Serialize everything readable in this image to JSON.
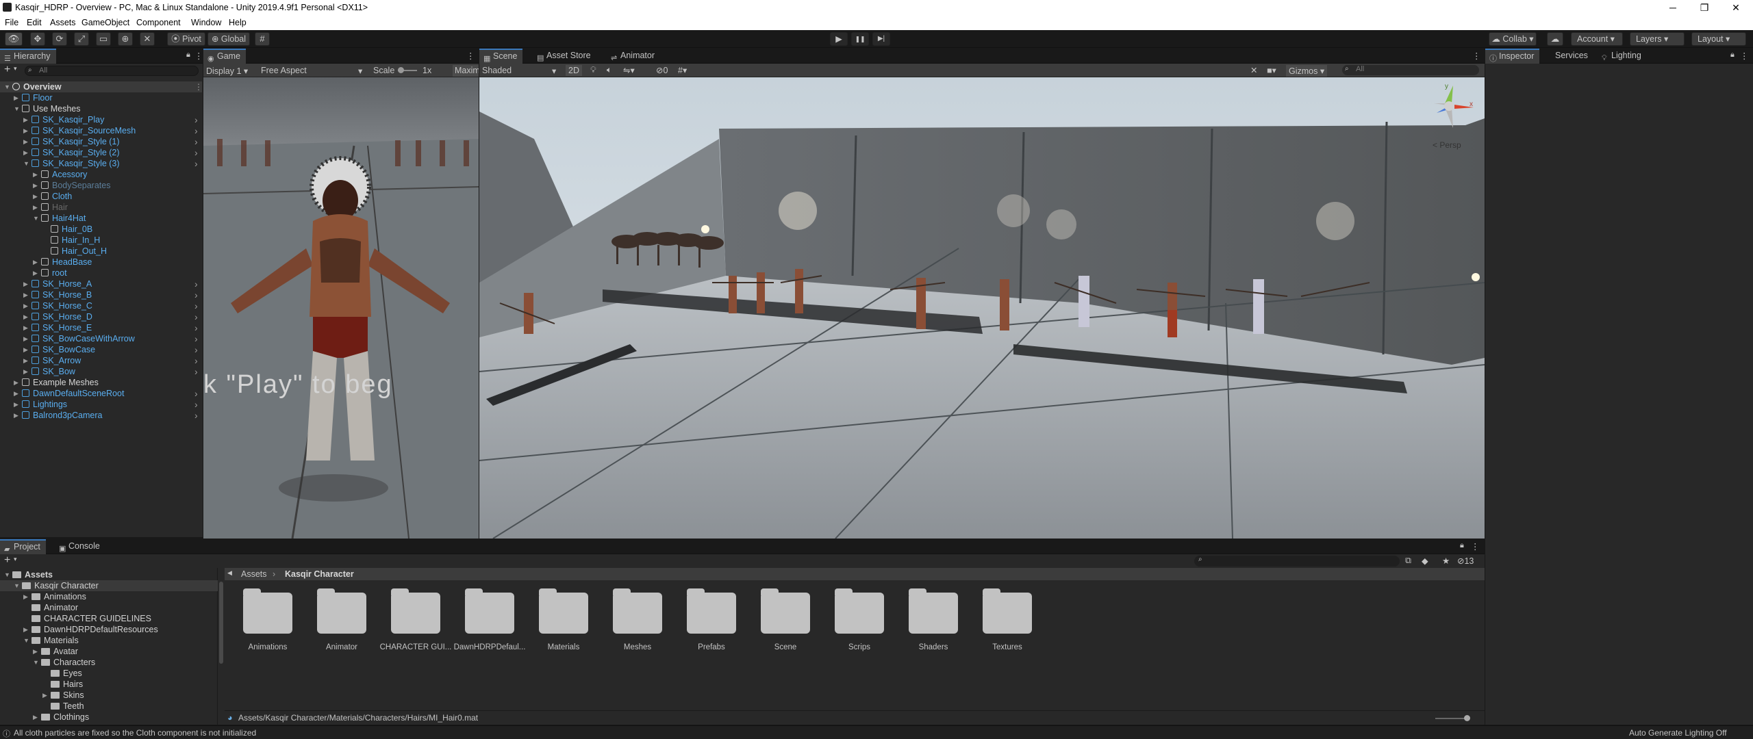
{
  "window": {
    "title": "Kasqir_HDRP - Overview - PC, Mac & Linux Standalone - Unity 2019.4.9f1 Personal <DX11>",
    "min": "─",
    "max": "❐",
    "close": "✕"
  },
  "menu": [
    "File",
    "Edit",
    "Assets",
    "GameObject",
    "Component",
    "Window",
    "Help"
  ],
  "toolbar": {
    "pivot": "Pivot",
    "global": "Global",
    "play": "▶",
    "pause": "❚❚",
    "step": "▶|",
    "collab": "Collab",
    "account": "Account",
    "layers": "Layers",
    "layout": "Layout"
  },
  "hierarchy": {
    "tab": "Hierarchy",
    "search_placeholder": "All",
    "add": "+",
    "items": [
      {
        "label": "Overview",
        "d": 0,
        "exp": "open",
        "ic": "unity",
        "c": "white"
      },
      {
        "label": "Floor",
        "d": 1,
        "exp": "closed",
        "ic": "cube",
        "c": "blue"
      },
      {
        "label": "Use Meshes",
        "d": 1,
        "exp": "open",
        "ic": "gray",
        "c": "white"
      },
      {
        "label": "SK_Kasqir_Play",
        "d": 2,
        "exp": "closed",
        "ic": "cube",
        "c": "blue",
        "more": 1
      },
      {
        "label": "SK_Kasqir_SourceMesh",
        "d": 2,
        "exp": "closed",
        "ic": "cube",
        "c": "blue",
        "more": 1
      },
      {
        "label": "SK_Kasqir_Style (1)",
        "d": 2,
        "exp": "closed",
        "ic": "cube",
        "c": "blue",
        "more": 1
      },
      {
        "label": "SK_Kasqir_Style (2)",
        "d": 2,
        "exp": "closed",
        "ic": "cube",
        "c": "blue",
        "more": 1
      },
      {
        "label": "SK_Kasqir_Style (3)",
        "d": 2,
        "exp": "open",
        "ic": "cube",
        "c": "blue",
        "more": 1
      },
      {
        "label": "Acessory",
        "d": 3,
        "exp": "closed",
        "ic": "gray",
        "c": "blue"
      },
      {
        "label": "BodySeparates",
        "d": 3,
        "exp": "closed",
        "ic": "gray",
        "c": "dim"
      },
      {
        "label": "Cloth",
        "d": 3,
        "exp": "closed",
        "ic": "gray",
        "c": "blue"
      },
      {
        "label": "Hair",
        "d": 3,
        "exp": "closed",
        "ic": "gray",
        "c": "dim2"
      },
      {
        "label": "Hair4Hat",
        "d": 3,
        "exp": "open",
        "ic": "gray",
        "c": "blue"
      },
      {
        "label": "Hair_0B",
        "d": 4,
        "exp": "",
        "ic": "gray",
        "c": "blue"
      },
      {
        "label": "Hair_In_H",
        "d": 4,
        "exp": "",
        "ic": "gray",
        "c": "blue"
      },
      {
        "label": "Hair_Out_H",
        "d": 4,
        "exp": "",
        "ic": "gray",
        "c": "blue"
      },
      {
        "label": "HeadBase",
        "d": 3,
        "exp": "closed",
        "ic": "gray",
        "c": "blue"
      },
      {
        "label": "root",
        "d": 3,
        "exp": "closed",
        "ic": "gray",
        "c": "blue"
      },
      {
        "label": "SK_Horse_A",
        "d": 2,
        "exp": "closed",
        "ic": "cube",
        "c": "blue",
        "more": 1
      },
      {
        "label": "SK_Horse_B",
        "d": 2,
        "exp": "closed",
        "ic": "cube",
        "c": "blue",
        "more": 1
      },
      {
        "label": "SK_Horse_C",
        "d": 2,
        "exp": "closed",
        "ic": "cube",
        "c": "blue",
        "more": 1
      },
      {
        "label": "SK_Horse_D",
        "d": 2,
        "exp": "closed",
        "ic": "cube",
        "c": "blue",
        "more": 1
      },
      {
        "label": "SK_Horse_E",
        "d": 2,
        "exp": "closed",
        "ic": "cube",
        "c": "blue",
        "more": 1
      },
      {
        "label": "SK_BowCaseWithArrow",
        "d": 2,
        "exp": "closed",
        "ic": "cube",
        "c": "blue",
        "more": 1
      },
      {
        "label": "SK_BowCase",
        "d": 2,
        "exp": "closed",
        "ic": "cube",
        "c": "blue",
        "more": 1
      },
      {
        "label": "SK_Arrow",
        "d": 2,
        "exp": "closed",
        "ic": "cube",
        "c": "blue",
        "more": 1
      },
      {
        "label": "SK_Bow",
        "d": 2,
        "exp": "closed",
        "ic": "cube",
        "c": "blue",
        "more": 1
      },
      {
        "label": "Example Meshes",
        "d": 1,
        "exp": "closed",
        "ic": "gray",
        "c": "white"
      },
      {
        "label": "DawnDefaultSceneRoot",
        "d": 1,
        "exp": "closed",
        "ic": "cube",
        "c": "blue",
        "more": 1
      },
      {
        "label": "Lightings",
        "d": 1,
        "exp": "closed",
        "ic": "cube",
        "c": "blue",
        "more": 1
      },
      {
        "label": "Balrond3pCamera",
        "d": 1,
        "exp": "closed",
        "ic": "cube",
        "c": "blue",
        "more": 1
      }
    ]
  },
  "game": {
    "tab": "Game",
    "display": "Display 1",
    "aspect": "Free Aspect",
    "scale_label": "Scale",
    "scale_value": "1x",
    "maximize": "Maximi",
    "overlay_text": "k \"Play\" to beg"
  },
  "scene": {
    "tabs": [
      "Scene",
      "Asset Store",
      "Animator"
    ],
    "shading": "Shaded",
    "mode_2d": "2D",
    "hidden_count": "0",
    "gizmos": "Gizmos",
    "search_placeholder": "All",
    "persp": "< Persp",
    "axis_y": "y",
    "axis_x": "x"
  },
  "inspector": {
    "tabs": [
      "Inspector",
      "Services",
      "Lighting"
    ]
  },
  "project": {
    "tabs": [
      "Project",
      "Console"
    ],
    "hidden_count": "13",
    "breadcrumb_root": "Assets",
    "breadcrumb_current": "Kasqir Character",
    "path": "Assets/Kasqir Character/Materials/Characters/Hairs/MI_Hair0.mat",
    "tree": [
      {
        "label": "Assets",
        "d": 0,
        "exp": "open",
        "bold": true
      },
      {
        "label": "Kasqir Character",
        "d": 1,
        "exp": "open",
        "sel": true
      },
      {
        "label": "Animations",
        "d": 2,
        "exp": "closed"
      },
      {
        "label": "Animator",
        "d": 2,
        "exp": ""
      },
      {
        "label": "CHARACTER GUIDELINES",
        "d": 2,
        "exp": ""
      },
      {
        "label": "DawnHDRPDefaultResources",
        "d": 2,
        "exp": "closed"
      },
      {
        "label": "Materials",
        "d": 2,
        "exp": "open"
      },
      {
        "label": "Avatar",
        "d": 3,
        "exp": "closed"
      },
      {
        "label": "Characters",
        "d": 3,
        "exp": "open"
      },
      {
        "label": "Eyes",
        "d": 4,
        "exp": ""
      },
      {
        "label": "Hairs",
        "d": 4,
        "exp": ""
      },
      {
        "label": "Skins",
        "d": 4,
        "exp": "closed"
      },
      {
        "label": "Teeth",
        "d": 4,
        "exp": ""
      },
      {
        "label": "Clothings",
        "d": 3,
        "exp": "closed"
      }
    ],
    "folders": [
      "Animations",
      "Animator",
      "CHARACTER GUI...",
      "DawnHDRPDefaul...",
      "Materials",
      "Meshes",
      "Prefabs",
      "Scene",
      "Scrips",
      "Shaders",
      "Textures"
    ]
  },
  "status": {
    "message": "All cloth particles are fixed so the Cloth component is not initialized",
    "right": "Auto Generate Lighting Off"
  }
}
